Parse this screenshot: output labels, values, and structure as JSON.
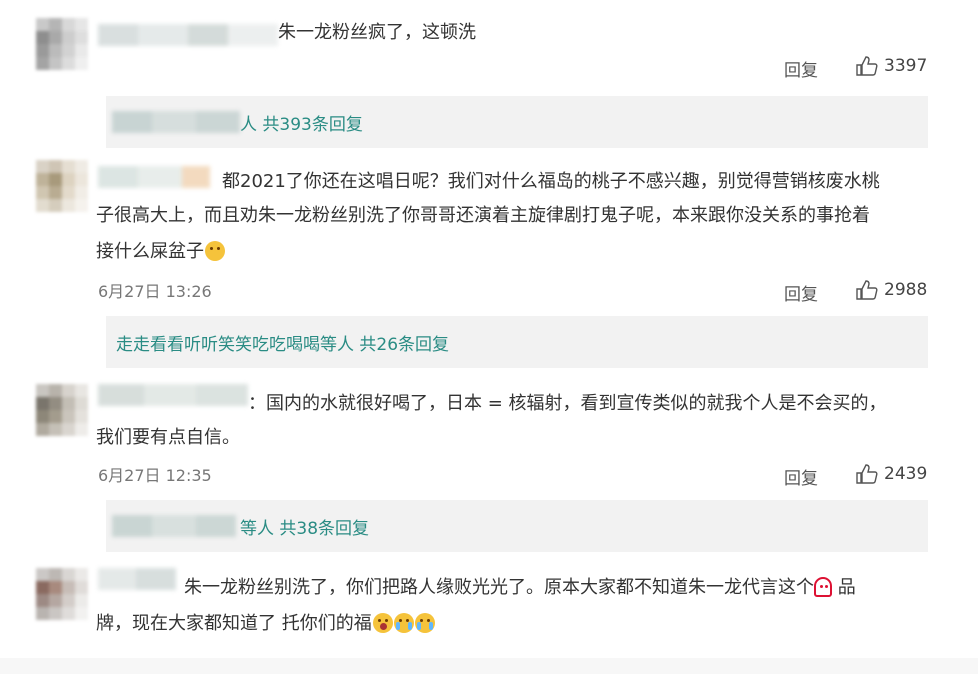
{
  "comments": [
    {
      "text_lines": [
        "朱一龙粉丝疯了，这顿洗"
      ],
      "time": "",
      "reply_label": "回复",
      "likes": "3397",
      "sub_replies": {
        "text": "人 共393条回复"
      }
    },
    {
      "text_lines": [
        "都2021了你还在这唱日呢？我们对什么福岛的桃子不感兴趣，别觉得营销核废水桃",
        "子很高大上，而且劝朱一龙粉丝别洗了你哥哥还演着主旋律剧打鬼子呢，本来跟你没关系的事抢着",
        "接什么屎盆子"
      ],
      "time": "6月27日 13:26",
      "reply_label": "回复",
      "likes": "2988",
      "sub_replies": {
        "user": "走走看看听听笑笑吃吃喝喝",
        "text": " 等人 共26条回复"
      }
    },
    {
      "text_lines": [
        "：国内的水就很好喝了，日本 = 核辐射，看到宣传类似的就我个人是不会买的，",
        "我们要有点自信。"
      ],
      "time": "6月27日 12:35",
      "reply_label": "回复",
      "likes": "2439",
      "sub_replies": {
        "text": "等人 共38条回复"
      }
    },
    {
      "text_lines": [
        "朱一龙粉丝别洗了，你们把路人缘败光光了。原本大家都不知道朱一龙代言这个",
        "牌，现在大家都知道了 托你们的福"
      ],
      "line1_tail": " 品",
      "time": "",
      "reply_label": "",
      "likes": ""
    }
  ],
  "colors": {
    "link": "#2a8c84",
    "subbar_bg": "#f2f2f2",
    "text": "#333333"
  }
}
